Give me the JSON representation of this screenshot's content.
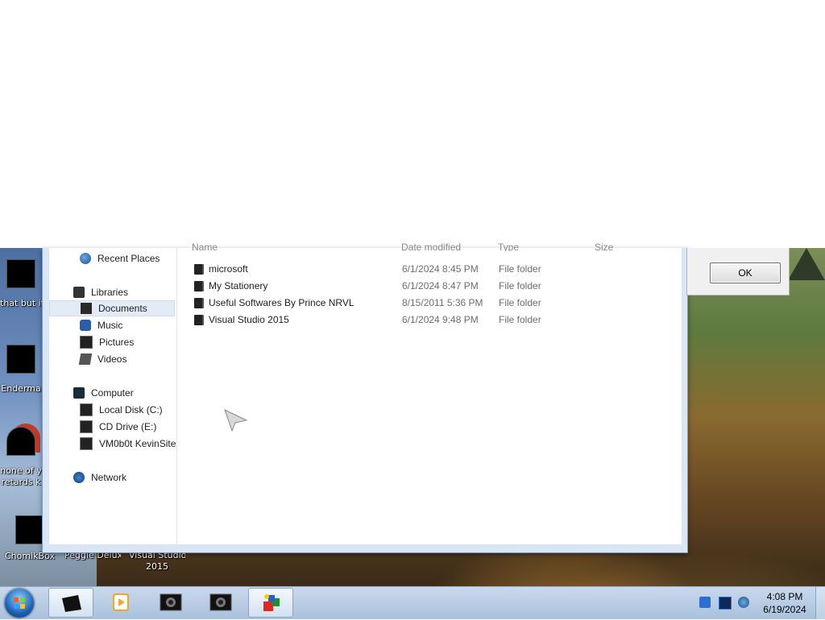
{
  "navigation": {
    "recent_places": "Recent Places",
    "libraries": "Libraries",
    "documents": "Documents",
    "music": "Music",
    "pictures": "Pictures",
    "videos": "Videos",
    "computer": "Computer",
    "local_disk": "Local Disk (C:)",
    "cd_drive": "CD Drive (E:)",
    "network_drive": "VM0b0t KevinSite",
    "network": "Network"
  },
  "columns": {
    "name": "Name",
    "date_modified": "Date modified",
    "type": "Type",
    "size": "Size"
  },
  "files": [
    {
      "name": "microsoft",
      "date": "6/1/2024 8:45 PM",
      "type": "File folder"
    },
    {
      "name": "My Stationery",
      "date": "6/1/2024 8:47 PM",
      "type": "File folder"
    },
    {
      "name": "Useful Softwares By Prince NRVL",
      "date": "8/15/2011 5:36 PM",
      "type": "File folder"
    },
    {
      "name": "Visual Studio 2015",
      "date": "6/1/2024 9:48 PM",
      "type": "File folder"
    }
  ],
  "dialog": {
    "ok_label": "OK"
  },
  "desktop_icons": [
    {
      "label1": "that but it",
      "label2": ""
    },
    {
      "label1": "Enderma",
      "label2": ""
    },
    {
      "label1": "none of y",
      "label2": "retards k"
    },
    {
      "label1": "ChomikBox",
      "label2": ""
    },
    {
      "label1": "Peggle Deluxe",
      "label2": ""
    },
    {
      "label1": "Visual Studio",
      "label2": "2015"
    }
  ],
  "taskbar": {
    "time": "4:08 PM",
    "date": "6/19/2024"
  }
}
